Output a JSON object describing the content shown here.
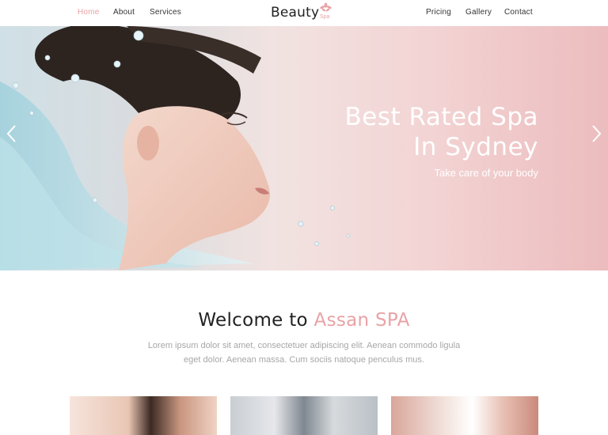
{
  "nav": {
    "left": [
      "Home",
      "About",
      "Services"
    ],
    "right": [
      "Pricing",
      "Gallery",
      "Contact"
    ],
    "active": "Home"
  },
  "logo": {
    "name": "Beauty",
    "sub": "Spa"
  },
  "hero": {
    "title_line1": "Best Rated Spa",
    "title_line2": "In Sydney",
    "subtitle": "Take care of your body",
    "prev_icon": "chevron-left-icon",
    "next_icon": "chevron-right-icon"
  },
  "welcome": {
    "title_prefix": "Welcome to",
    "title_accent": "Assan SPA",
    "text": "Lorem ipsum dolor sit amet, consectetuer adipiscing elit. Aenean commodo ligula eget dolor. Aenean massa. Cum sociis natoque penculus mus."
  },
  "colors": {
    "accent": "#e8a3a6",
    "text": "#222222",
    "muted": "#a7a7a7"
  }
}
